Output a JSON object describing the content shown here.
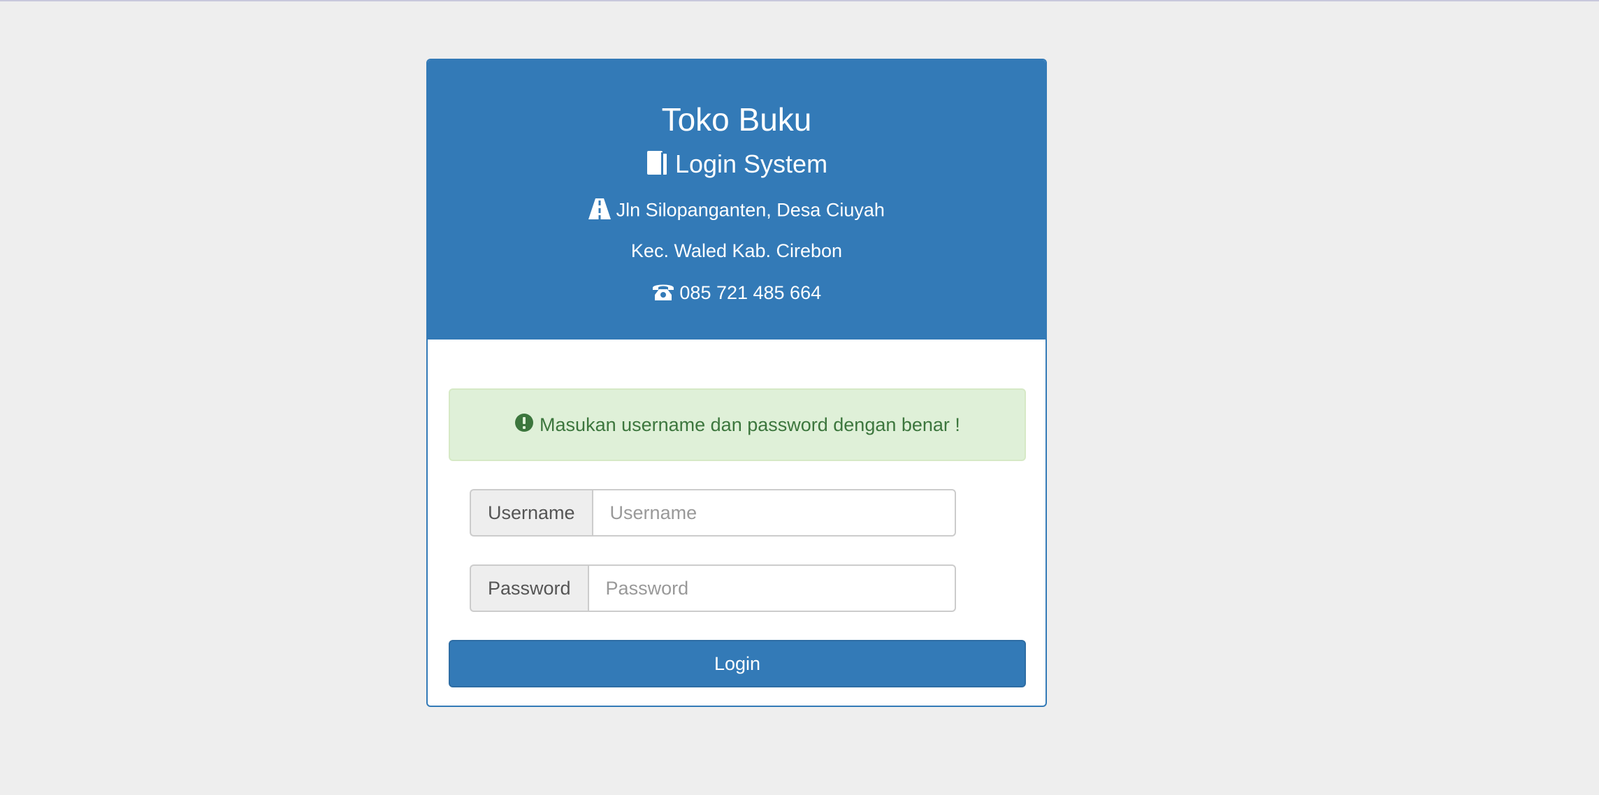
{
  "header": {
    "title": "Toko Buku",
    "subtitle": "Login System",
    "address_line1": "Jln Silopanganten, Desa Ciuyah",
    "address_line2": "Kec. Waled Kab. Cirebon",
    "phone": "085 721 485 664",
    "icons": {
      "subtitle": "book-icon",
      "address": "road-icon",
      "phone": "phone-icon"
    }
  },
  "alert": {
    "icon": "exclamation-circle-icon",
    "message": "Masukan username dan password dengan benar !"
  },
  "form": {
    "username_label": "Username",
    "username_placeholder": "Username",
    "username_value": "",
    "password_label": "Password",
    "password_placeholder": "Password",
    "password_value": "",
    "login_label": "Login"
  },
  "colors": {
    "primary": "#337ab7",
    "background": "#eeeeee",
    "alert_bg": "#dff0d8",
    "alert_text": "#3c763d"
  }
}
